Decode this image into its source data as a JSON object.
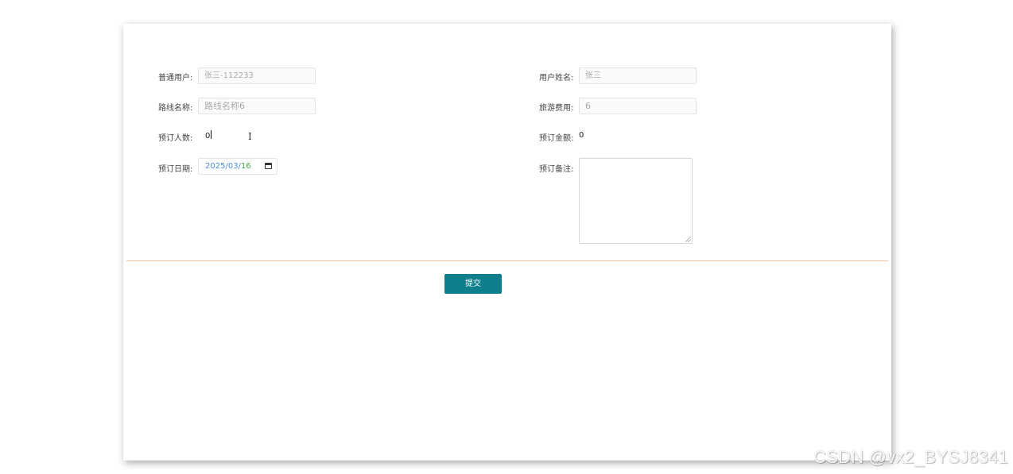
{
  "form": {
    "user_label": "普通用户:",
    "user_value": "张三-112233",
    "name_label": "用户姓名:",
    "name_value": "张三",
    "route_label": "路线名称:",
    "route_value": "路线名称6",
    "fee_label": "旅游费用:",
    "fee_value": "6",
    "people_label": "预订人数:",
    "people_value": "0",
    "amount_label": "预订金额:",
    "amount_value": "0",
    "date_label": "预订日期:",
    "date_year": "2025",
    "date_month": "03",
    "date_day": "16",
    "date_sep": "/",
    "note_label": "预订备注:",
    "note_value": ""
  },
  "actions": {
    "submit_label": "提交"
  },
  "watermark": {
    "text": "CSDN @vx2_BYSJ8341"
  },
  "colors": {
    "accent": "#0f7f8d",
    "divider": "#f3c9a4",
    "date_year_month": "#4b8ed8",
    "date_day": "#3fae3f"
  },
  "icons": {
    "cursor": "text-cursor-icon",
    "date": "calendar-icon"
  }
}
